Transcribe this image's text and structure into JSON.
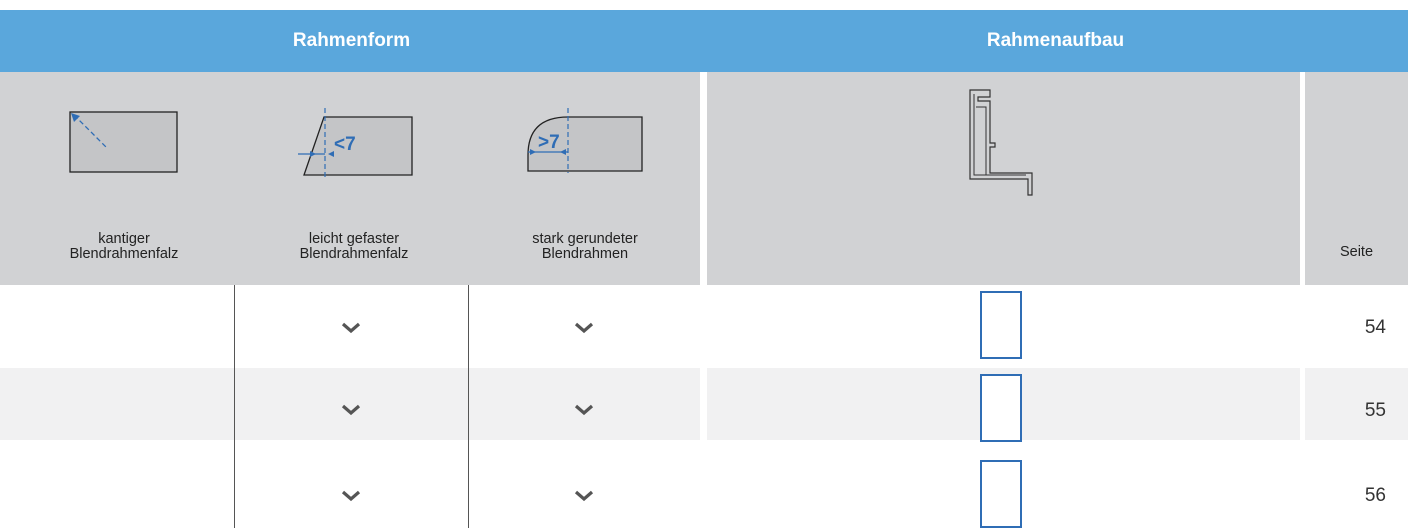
{
  "header": {
    "rahmenform": "Rahmenform",
    "rahmenaufbau": "Rahmenaufbau"
  },
  "columns": {
    "kantig": "kantiger\nBlendrahmenfalz",
    "gefast": "leicht gefaster\nBlendrahmenfalz",
    "gerundet": "stark gerundeter\nBlendrahmen",
    "seite": "Seite"
  },
  "diagram_labels": {
    "lt7": "<7",
    "gt7": ">7"
  },
  "icons": {
    "check": "check-icon",
    "profile": "frame-profile-icon",
    "rect": "rectangle-outline-icon"
  },
  "colors": {
    "header_bg": "#5aa7dc",
    "accent_blue": "#2f6db5",
    "gray_panel": "#d1d2d4"
  },
  "rows": [
    {
      "gefast": true,
      "gerundet": true,
      "seite": "54"
    },
    {
      "gefast": true,
      "gerundet": true,
      "seite": "55"
    },
    {
      "gefast": true,
      "gerundet": true,
      "seite": "56"
    }
  ]
}
